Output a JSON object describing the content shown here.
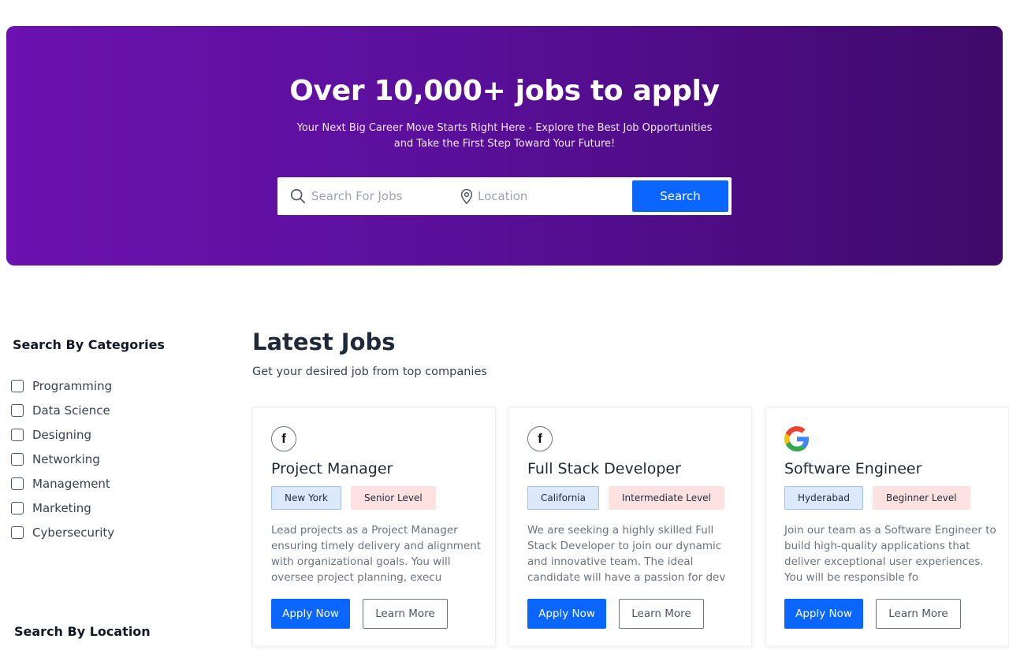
{
  "hero": {
    "title": "Over 10,000+ jobs to apply",
    "subtitle": "Your Next Big Career Move Starts Right Here - Explore the Best Job Opportunities and Take the First Step Toward Your Future!",
    "search_placeholder": "Search For Jobs",
    "location_placeholder": "Location",
    "search_button": "Search"
  },
  "sidebar": {
    "categories_title": "Search By Categories",
    "categories": [
      "Programming",
      "Data Science",
      "Designing",
      "Networking",
      "Management",
      "Marketing",
      "Cybersecurity"
    ],
    "location_title": "Search By Location"
  },
  "main": {
    "title": "Latest Jobs",
    "subtitle": "Get your desired job from top companies",
    "jobs": [
      {
        "logo": "facebook-icon",
        "title": "Project Manager",
        "location": "New York",
        "level": "Senior Level",
        "description": "Lead projects as a Project Manager ensuring timely delivery and alignment with organizational goals. You will oversee project planning, execu",
        "apply": "Apply Now",
        "learn": "Learn More"
      },
      {
        "logo": "facebook-icon",
        "title": "Full Stack Developer",
        "location": "California",
        "level": "Intermediate Level",
        "description": "We are seeking a highly skilled Full Stack Developer to join our dynamic and innovative team. The ideal candidate will have a passion for dev",
        "apply": "Apply Now",
        "learn": "Learn More"
      },
      {
        "logo": "google-icon",
        "title": "Software Engineer",
        "location": "Hyderabad",
        "level": "Beginner Level",
        "description": "Join our team as a Software Engineer to build high-quality applications that deliver exceptional user experiences. You will be responsible fo",
        "apply": "Apply Now",
        "learn": "Learn More"
      }
    ]
  },
  "colors": {
    "hero_gradient_start": "#6b12b0",
    "hero_gradient_end": "#3f0a6a",
    "primary_button": "#0a66ff",
    "location_tag_bg": "#dbe9fb",
    "level_tag_bg": "#fde2e1"
  }
}
